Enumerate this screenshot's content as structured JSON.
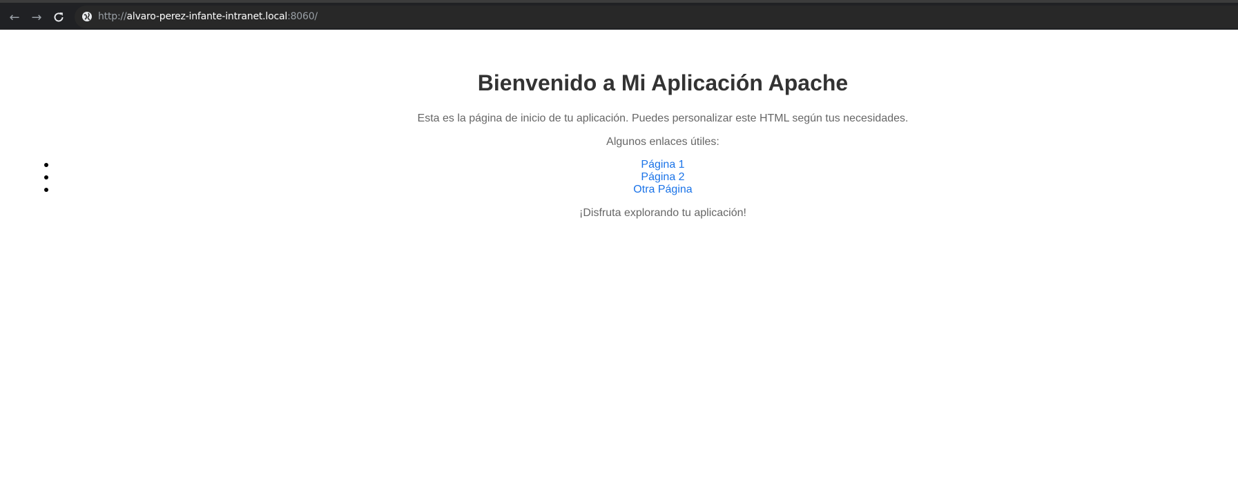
{
  "browser": {
    "url_scheme": "http://",
    "url_host": "alvaro-perez-infante-intranet.local",
    "url_rest": ":8060/",
    "icons": {
      "back": "arrow-left-icon",
      "forward": "arrow-right-icon",
      "reload": "reload-icon",
      "site_info": "globe-icon"
    }
  },
  "page": {
    "title": "Bienvenido a Mi Aplicación Apache",
    "intro": "Esta es la página de inicio de tu aplicación. Puedes personalizar este HTML según tus necesidades.",
    "links_label": "Algunos enlaces útiles:",
    "links": [
      {
        "label": "Página 1"
      },
      {
        "label": "Página 2"
      },
      {
        "label": "Otra Página"
      }
    ],
    "outro": "¡Disfruta explorando tu aplicación!"
  },
  "colors": {
    "chrome_bg": "#202124",
    "link": "#1a73e8",
    "heading": "#333333",
    "body_text": "#666666"
  }
}
